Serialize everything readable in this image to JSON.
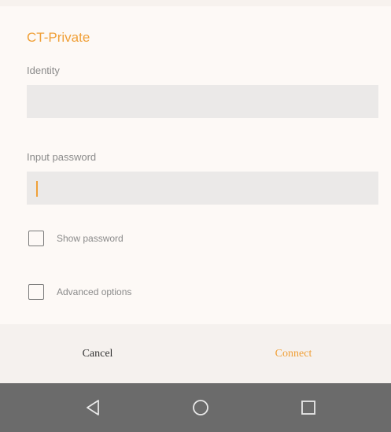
{
  "dialog": {
    "title": "CT-Private",
    "identity_label": "Identity",
    "identity_value": "",
    "password_label": "Input password",
    "password_value": "",
    "show_password_label": "Show password",
    "show_password_checked": false,
    "advanced_options_label": "Advanced options",
    "advanced_options_checked": false
  },
  "buttons": {
    "cancel_label": "Cancel",
    "connect_label": "Connect"
  },
  "nav": {
    "back_icon": "back-triangle-icon",
    "home_icon": "home-circle-icon",
    "recent_icon": "recent-apps-square-icon"
  },
  "colors": {
    "accent": "#f0a038",
    "field_bg": "#ebe9e8",
    "nav_bg": "#6b6b6b"
  }
}
